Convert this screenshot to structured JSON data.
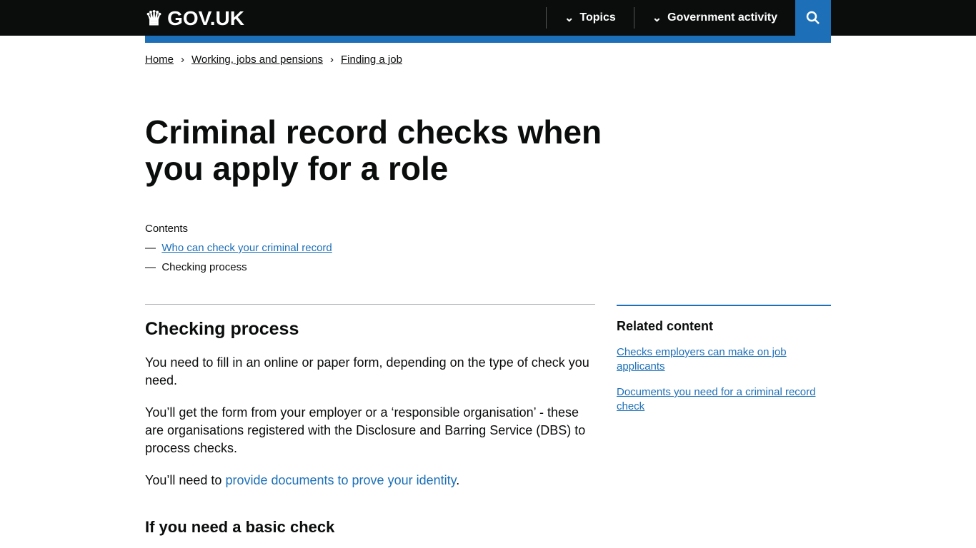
{
  "header": {
    "logo": "GOV.UK",
    "nav": [
      "Topics",
      "Government activity"
    ]
  },
  "breadcrumbs": [
    "Home",
    "Working, jobs and pensions",
    "Finding a job"
  ],
  "title": "Criminal record checks when you apply for a role",
  "contents": {
    "label": "Contents",
    "items": [
      {
        "text": "Who can check your criminal record",
        "link": true
      },
      {
        "text": "Checking process",
        "link": false
      }
    ]
  },
  "main": {
    "heading": "Checking process",
    "p1": "You need to fill in an online or paper form, depending on the type of check you need.",
    "p2": "You’ll get the form from your employer or a ‘responsible organisation’ - these are organisations registered with the Disclosure and Barring Service (DBS) to process checks.",
    "p3_pre": "You’ll need to ",
    "p3_link": "provide documents to prove your identity",
    "p3_post": ".",
    "subheading": "If you need a basic check"
  },
  "related": {
    "heading": "Related content",
    "links": [
      "Checks employers can make on job applicants",
      "Documents you need for a criminal record check"
    ]
  }
}
